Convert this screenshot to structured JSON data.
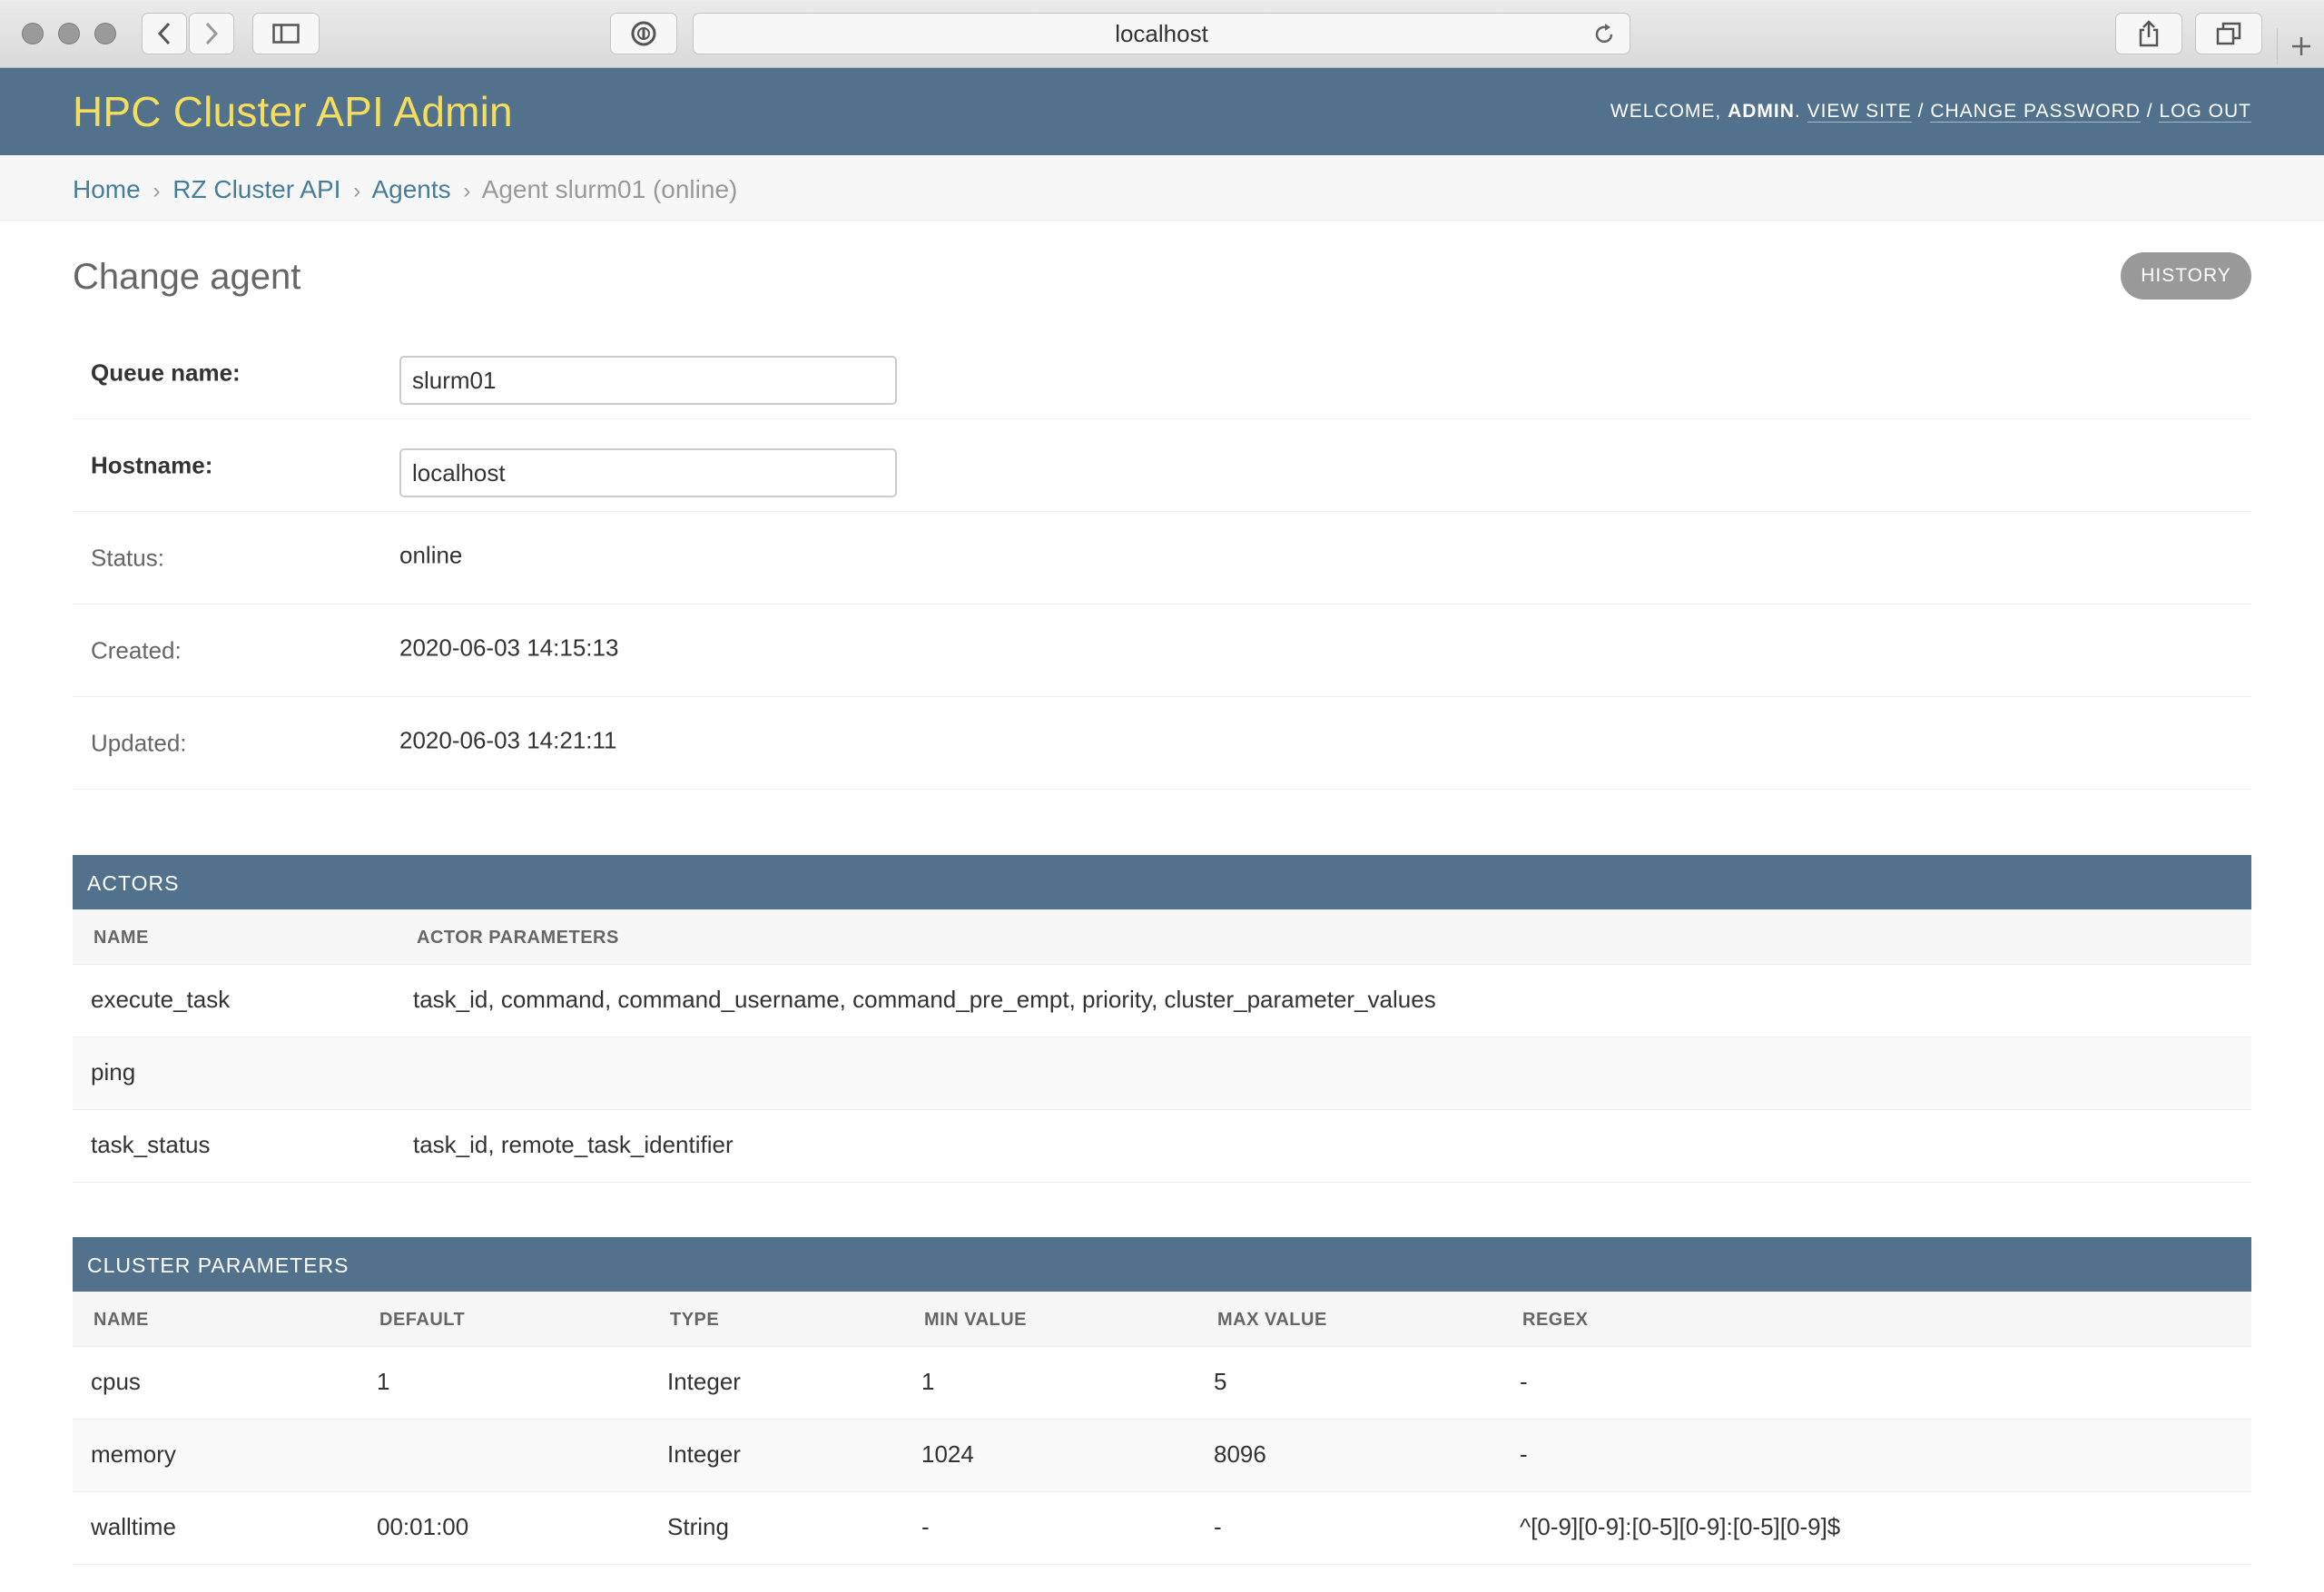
{
  "browser": {
    "url": "localhost"
  },
  "header": {
    "branding": "HPC Cluster API Admin",
    "welcome": "WELCOME,",
    "username": "ADMIN",
    "view_site": "VIEW SITE",
    "change_password": "CHANGE PASSWORD",
    "log_out": "LOG OUT",
    "sep": "/"
  },
  "breadcrumbs": {
    "home": "Home",
    "app": "RZ Cluster API",
    "model": "Agents",
    "current": "Agent slurm01 (online)",
    "sep": "›"
  },
  "page": {
    "title": "Change agent",
    "history_label": "HISTORY"
  },
  "form": {
    "queue_name_label": "Queue name:",
    "queue_name_value": "slurm01",
    "hostname_label": "Hostname:",
    "hostname_value": "localhost",
    "status_label": "Status:",
    "status_value": "online",
    "created_label": "Created:",
    "created_value": "2020-06-03 14:15:13",
    "updated_label": "Updated:",
    "updated_value": "2020-06-03 14:21:11"
  },
  "actors": {
    "title": "ACTORS",
    "columns": [
      "NAME",
      "ACTOR PARAMETERS"
    ],
    "rows": [
      {
        "name": "execute_task",
        "params": "task_id, command, command_username, command_pre_empt, priority, cluster_parameter_values"
      },
      {
        "name": "ping",
        "params": ""
      },
      {
        "name": "task_status",
        "params": "task_id, remote_task_identifier"
      }
    ]
  },
  "cluster_parameters": {
    "title": "CLUSTER PARAMETERS",
    "columns": [
      "NAME",
      "DEFAULT",
      "TYPE",
      "MIN VALUE",
      "MAX VALUE",
      "REGEX"
    ],
    "rows": [
      {
        "name": "cpus",
        "default": "1",
        "type": "Integer",
        "min": "1",
        "max": "5",
        "regex": "-"
      },
      {
        "name": "memory",
        "default": "",
        "type": "Integer",
        "min": "1024",
        "max": "8096",
        "regex": "-"
      },
      {
        "name": "walltime",
        "default": "00:01:00",
        "type": "String",
        "min": "-",
        "max": "-",
        "regex": "^[0-9][0-9]:[0-5][0-9]:[0-5][0-9]$"
      }
    ]
  },
  "colors": {
    "header_bg": "#52718c",
    "branding": "#f5dd5d",
    "link": "#447e9b"
  }
}
